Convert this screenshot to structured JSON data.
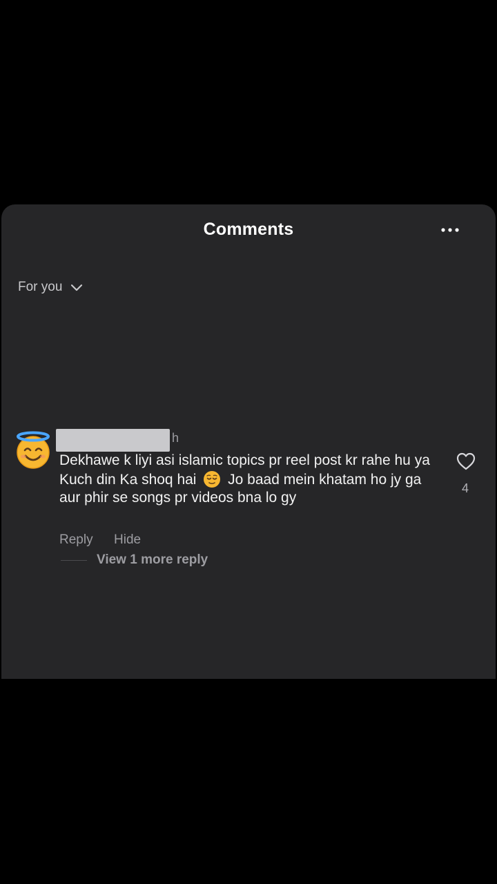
{
  "header": {
    "title": "Comments",
    "more_icon": "more-horizontal-icon"
  },
  "filter": {
    "label": "For you",
    "icon": "chevron-down-icon"
  },
  "comment": {
    "avatar_icon": "smiling-face-with-halo-emoji",
    "time": "h",
    "text_part1": "Dekhawe k liyi asi islamic topics pr reel post kr rahe hu ya Kuch din Ka shoq hai",
    "inline_emoji": "relieved-face-emoji",
    "text_part2": "Jo baad mein khatam ho jy ga aur phir se songs pr videos bna lo gy",
    "like_icon": "heart-outline-icon",
    "like_count": "4",
    "reply_label": "Reply",
    "hide_label": "Hide",
    "view_replies_label": "View 1 more reply"
  },
  "colors": {
    "background": "#000000",
    "sheet": "#262628",
    "primary_text": "#f2f2f2",
    "secondary_text": "#9d9da2",
    "redacted_username": "#c9c9cc"
  }
}
